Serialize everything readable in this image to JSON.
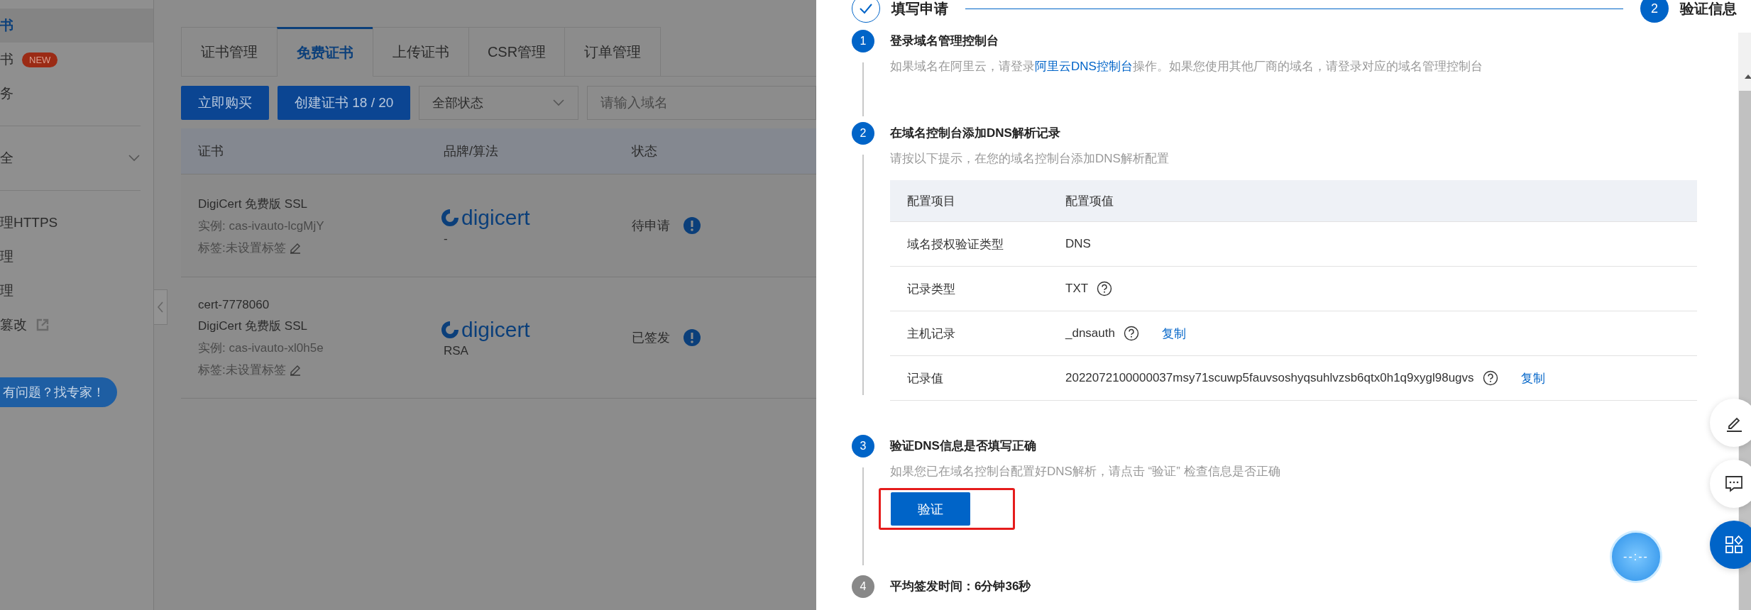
{
  "sidebar": {
    "items": [
      {
        "label": "书",
        "selected": true,
        "kind": "plain"
      },
      {
        "label": "书",
        "selected": false,
        "kind": "badge",
        "badge": "NEW"
      },
      {
        "label": "务",
        "selected": false,
        "kind": "plain"
      },
      {
        "label": "全",
        "selected": false,
        "kind": "group",
        "expanded": false
      },
      {
        "label": "理HTTPS",
        "selected": false,
        "kind": "plain"
      },
      {
        "label": "理",
        "selected": false,
        "kind": "plain"
      },
      {
        "label": "理",
        "selected": false,
        "kind": "plain"
      },
      {
        "label": "篡改",
        "selected": false,
        "kind": "external"
      }
    ],
    "help_button": "有问题？找专家！"
  },
  "tabs": [
    {
      "label": "证书管理",
      "selected": false
    },
    {
      "label": "免费证书",
      "selected": true
    },
    {
      "label": "上传证书",
      "selected": false
    },
    {
      "label": "CSR管理",
      "selected": false
    },
    {
      "label": "订单管理",
      "selected": false
    }
  ],
  "toolbar": {
    "buy_button": "立即购买",
    "create_button": "创建证书 18 / 20",
    "status_select": "全部状态",
    "search": {
      "placeholder": "请输入域名"
    }
  },
  "table": {
    "columns": [
      "证书",
      "品牌/算法",
      "状态"
    ],
    "rows": [
      {
        "lines": [
          {
            "text": "DigiCert 免费版 SSL",
            "kind": "title"
          },
          {
            "text": "实例: cas-ivauto-lcgMjY",
            "kind": "meta"
          },
          {
            "text": "标签:未设置标签",
            "kind": "tag"
          }
        ],
        "brand": "digicert",
        "algorithm": "-",
        "status": "待申请"
      },
      {
        "lines": [
          {
            "text": "cert-7778060",
            "kind": "title"
          },
          {
            "text": "DigiCert 免费版 SSL",
            "kind": "title"
          },
          {
            "text": "实例: cas-ivauto-xl0h5e",
            "kind": "meta"
          },
          {
            "text": "标签:未设置标签",
            "kind": "tag"
          }
        ],
        "brand": "digicert",
        "algorithm": "RSA",
        "status": "已签发"
      }
    ]
  },
  "drawer": {
    "progress": [
      {
        "label": "填写申请",
        "done": true
      },
      {
        "label": "验证信息",
        "number": "2",
        "done": false
      }
    ],
    "steps": [
      {
        "number": "1",
        "title": "登录域名管理控制台",
        "pending": false,
        "description": [
          {
            "text": "如果域名在阿里云，请登录",
            "kind": "text"
          },
          {
            "text": "阿里云DNS控制台",
            "kind": "link"
          },
          {
            "text": "操作。如果您使用其他厂商的域名，请登录对应的域名管理控制台",
            "kind": "text"
          }
        ]
      },
      {
        "number": "2",
        "title": "在域名控制台添加DNS解析记录",
        "pending": false,
        "description": [
          {
            "text": "请按以下提示，在您的域名控制台添加DNS解析配置",
            "kind": "text"
          }
        ],
        "table": {
          "columns": [
            "配置项目",
            "配置项值"
          ],
          "rows": [
            {
              "label": "域名授权验证类型",
              "value": "DNS",
              "help": false
            },
            {
              "label": "记录类型",
              "value": "TXT",
              "help": true
            },
            {
              "label": "主机记录",
              "value": "_dnsauth",
              "help": true,
              "copy": "复制"
            },
            {
              "label": "记录值",
              "value": "2022072100000037msy71scuwp5fauvsoshyqsuhlvzsb6qtx0h1q9xygl98ugvs",
              "help": true,
              "copy": "复制"
            }
          ]
        }
      },
      {
        "number": "3",
        "title": "验证DNS信息是否填写正确",
        "pending": false,
        "description": [
          {
            "text": "如果您已在域名控制台配置好DNS解析，请点击 “验证” 检查信息是否正确",
            "kind": "text"
          }
        ],
        "button": "验证"
      },
      {
        "number": "4",
        "title": "平均签发时间：6分钟36秒",
        "pending": true
      }
    ],
    "timer": "--:--"
  }
}
